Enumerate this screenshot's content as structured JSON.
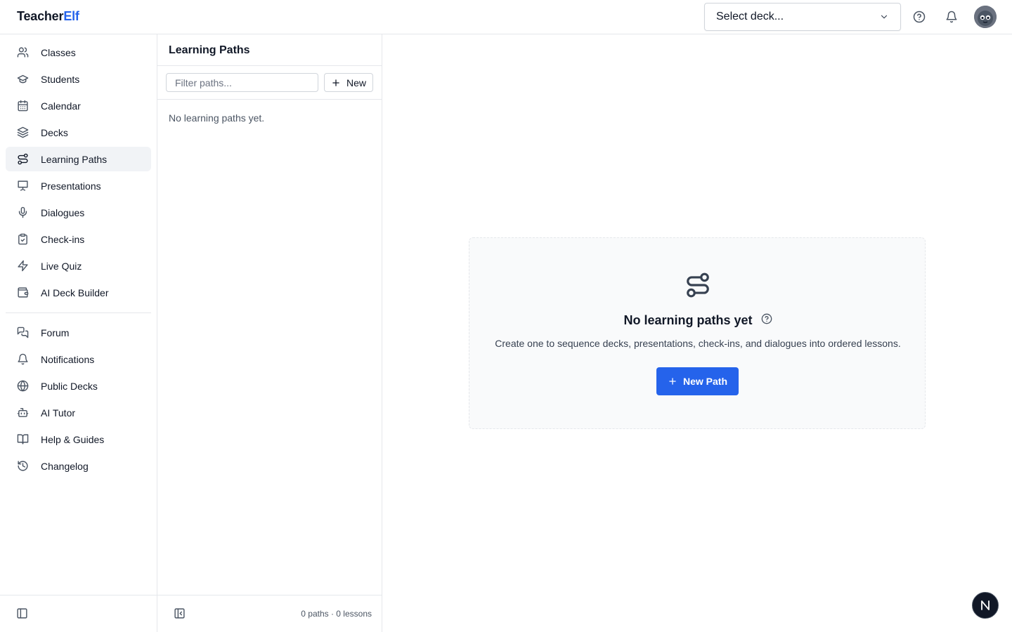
{
  "header": {
    "logo_part1": "Teacher",
    "logo_part2": "Elf",
    "deck_select_label": "Select deck..."
  },
  "sidebar": {
    "primary": [
      {
        "label": "Classes",
        "icon": "users-icon"
      },
      {
        "label": "Students",
        "icon": "graduation-cap-icon"
      },
      {
        "label": "Calendar",
        "icon": "calendar-icon"
      },
      {
        "label": "Decks",
        "icon": "layers-icon"
      },
      {
        "label": "Learning Paths",
        "icon": "route-icon",
        "active": true
      },
      {
        "label": "Presentations",
        "icon": "presentation-icon"
      },
      {
        "label": "Dialogues",
        "icon": "microphone-icon"
      },
      {
        "label": "Check-ins",
        "icon": "clipboard-check-icon"
      },
      {
        "label": "Live Quiz",
        "icon": "lightning-icon"
      },
      {
        "label": "AI Deck Builder",
        "icon": "wallet-icon"
      }
    ],
    "secondary": [
      {
        "label": "Forum",
        "icon": "chat-icon"
      },
      {
        "label": "Notifications",
        "icon": "bell-icon"
      },
      {
        "label": "Public Decks",
        "icon": "globe-icon"
      },
      {
        "label": "AI Tutor",
        "icon": "bot-icon"
      },
      {
        "label": "Help & Guides",
        "icon": "book-icon"
      },
      {
        "label": "Changelog",
        "icon": "history-icon"
      }
    ]
  },
  "paths_panel": {
    "title": "Learning Paths",
    "filter_placeholder": "Filter paths...",
    "new_label": "New",
    "empty_text": "No learning paths yet.",
    "footer_counts": "0 paths · 0 lessons"
  },
  "main": {
    "empty_title": "No learning paths yet",
    "empty_description": "Create one to sequence decks, presentations, check-ins, and dialogues into ordered lessons.",
    "new_path_label": "New Path"
  },
  "colors": {
    "accent": "#2563eb",
    "active_bg": "#f1f3f6",
    "border": "#e5e7eb"
  }
}
